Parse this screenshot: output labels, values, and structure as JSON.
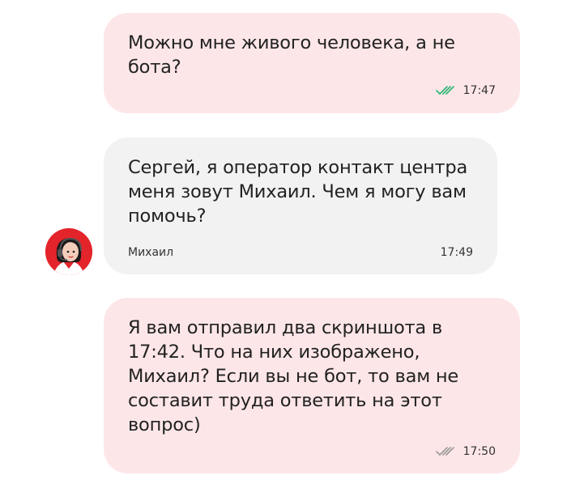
{
  "messages": [
    {
      "direction": "outgoing",
      "text": "Можно мне живого человека, а не\nбота?",
      "time": "17:47",
      "status_icon": "double-check-icon",
      "status_color": "#2bb673"
    },
    {
      "direction": "incoming",
      "text": "Сергей, я оператор контакт центра\nменя зовут Михаил. Чем я могу вам\nпомочь?",
      "sender": "Михаил",
      "time": "17:49",
      "avatar_icon": "operator-avatar-icon",
      "avatar_color": "#e3242b"
    },
    {
      "direction": "outgoing",
      "text": "Я вам отправил два скриншота в\n17:42. Что на них изображено,\nМихаил? Если вы не бот, то вам не\nсоставит труда ответить на этот\nвопрос)",
      "time": "17:50",
      "status_icon": "double-check-icon",
      "status_color": "#9a9a9a"
    }
  ],
  "colors": {
    "outgoing_bubble": "#fde6e8",
    "incoming_bubble": "#f2f2f2",
    "text": "#222222"
  }
}
